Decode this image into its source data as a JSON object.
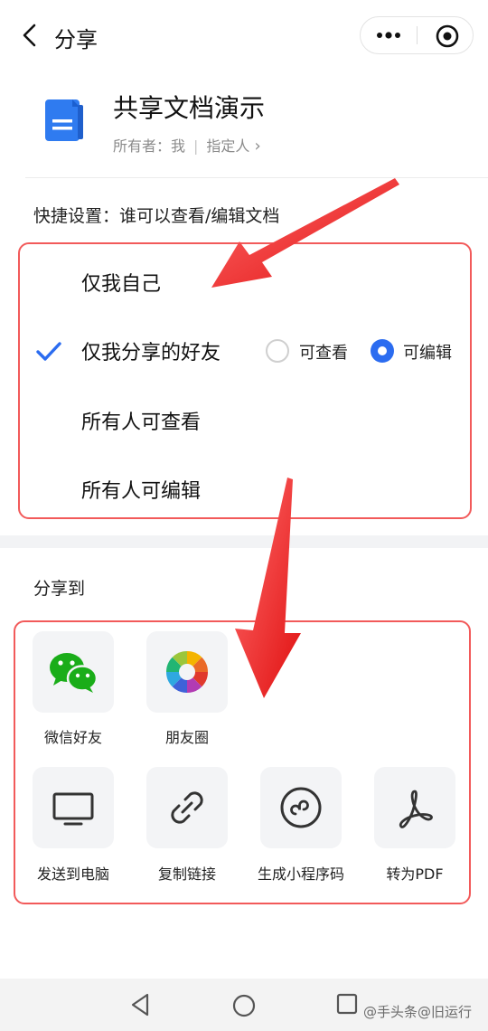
{
  "header": {
    "title": "分享"
  },
  "document": {
    "title": "共享文档演示",
    "owner_label": "所有者：",
    "owner_value": "我",
    "separator": "|",
    "assign_label": "指定人",
    "assign_chevron": "›"
  },
  "quick_settings": {
    "title": "快捷设置：谁可以查看/编辑文档",
    "options": [
      {
        "label": "仅我自己"
      },
      {
        "label": "仅我分享的好友"
      },
      {
        "label": "所有人可查看"
      },
      {
        "label": "所有人可编辑"
      }
    ],
    "selected_index": 1,
    "sub_options": [
      {
        "label": "可查看",
        "selected": false
      },
      {
        "label": "可编辑",
        "selected": true
      }
    ]
  },
  "share_to": {
    "title": "分享到",
    "row1": [
      {
        "label": "微信好友",
        "icon": "wechat-icon"
      },
      {
        "label": "朋友圈",
        "icon": "moments-icon"
      }
    ],
    "row2": [
      {
        "label": "发送到电脑",
        "icon": "monitor-icon"
      },
      {
        "label": "复制链接",
        "icon": "link-icon"
      },
      {
        "label": "生成小程序码",
        "icon": "mini-program-icon"
      },
      {
        "label": "转为PDF",
        "icon": "pdf-icon"
      }
    ]
  },
  "watermark": "@手头条@旧运行",
  "colors": {
    "accent": "#2b6cf0",
    "doc_icon": "#2f7bf0",
    "wechat_green": "#1aad19",
    "annotation_red": "#f03030"
  }
}
